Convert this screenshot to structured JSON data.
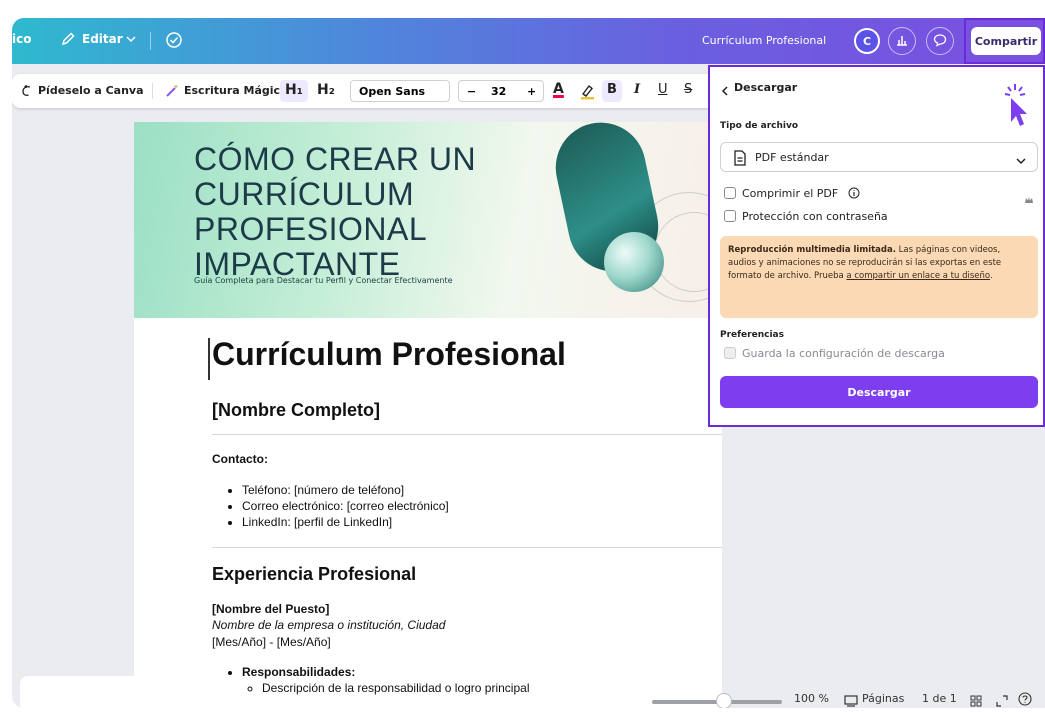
{
  "topbar": {
    "left_text": "ico",
    "edit_label": "Editar",
    "doc_title": "Currículum Profesional",
    "avatar_initial": "C",
    "share_label": "Compartir",
    "colors": {
      "gradient_start": "#2fb9cf",
      "gradient_end": "#7b4fe0",
      "highlight": "#6b2bd8"
    }
  },
  "toolbar": {
    "ask_canva": "Pídeselo a Canva",
    "magic_write": "Escritura Mágica",
    "h1": "H₁",
    "h2": "H₂",
    "font": "Open Sans",
    "minus": "−",
    "font_size": "32",
    "plus": "+",
    "text_color": "A",
    "highlight": "🖍",
    "bold": "B",
    "italic": "I",
    "underline": "U",
    "strike": "S"
  },
  "banner": {
    "title": "CÓMO CREAR UN CURRÍCULUM PROFESIONAL IMPACTANTE",
    "subtitle": "Guía Completa para Destacar tu Perfil y Conectar Efectivamente"
  },
  "document": {
    "heading": "Currículum Profesional",
    "name": "[Nombre Completo]",
    "contact_label": "Contacto:",
    "contact_items": [
      "Teléfono: [número de teléfono]",
      "Correo electrónico: [correo electrónico]",
      "LinkedIn: [perfil de LinkedIn]"
    ],
    "experience_heading": "Experiencia Profesional",
    "job_title": "[Nombre del Puesto]",
    "company": "Nombre de la empresa o institución, Ciudad",
    "dates": "[Mes/Año] - [Mes/Año]",
    "responsibilities_label": "Responsabilidades:",
    "responsibility_item": "Descripción de la responsabilidad o logro principal"
  },
  "download_panel": {
    "back_label": "Descargar",
    "file_type_label": "Tipo de archivo",
    "file_type_value": "PDF estándar",
    "compress_label": "Comprimir el PDF",
    "password_label": "Protección con contraseña",
    "warning_bold": "Reproducción multimedia limitada.",
    "warning_text": " Las páginas con videos, audios y animaciones no se reproducirán si las exportas en este formato de archivo. Prueba ",
    "warning_link": "a compartir un enlace a tu diseño",
    "warning_end": ".",
    "preferences_label": "Preferencias",
    "save_settings_label": "Guarda la configuración de descarga",
    "download_button": "Descargar",
    "colors": {
      "button": "#7d3ef0",
      "warning_bg": "#fad9b4"
    }
  },
  "bottombar": {
    "zoom": "100 %",
    "pages_label": "Páginas",
    "page_count": "1 de 1"
  }
}
